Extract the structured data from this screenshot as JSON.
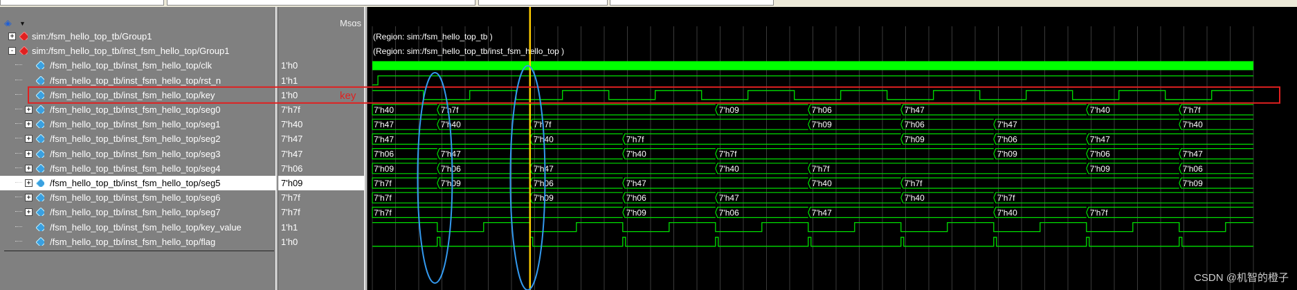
{
  "header": {
    "msgs_label": "Msgs"
  },
  "signals": [
    {
      "name": "sim:/fsm_hello_top_tb/Group1",
      "value": "",
      "kind": "group",
      "expander": "+",
      "indent": 0
    },
    {
      "name": "sim:/fsm_hello_top_tb/inst_fsm_hello_top/Group1",
      "value": "",
      "kind": "group",
      "expander": "-",
      "indent": 0
    },
    {
      "name": "/fsm_hello_top_tb/inst_fsm_hello_top/clk",
      "value": "1'h0",
      "kind": "bit",
      "expander": "",
      "indent": 1
    },
    {
      "name": "/fsm_hello_top_tb/inst_fsm_hello_top/rst_n",
      "value": "1'h1",
      "kind": "bit",
      "expander": "",
      "indent": 1
    },
    {
      "name": "/fsm_hello_top_tb/inst_fsm_hello_top/key",
      "value": "1'h0",
      "kind": "bit",
      "expander": "",
      "indent": 1
    },
    {
      "name": "/fsm_hello_top_tb/inst_fsm_hello_top/seg0",
      "value": "7'h7f",
      "kind": "bus",
      "expander": "+",
      "indent": 1
    },
    {
      "name": "/fsm_hello_top_tb/inst_fsm_hello_top/seg1",
      "value": "7'h40",
      "kind": "bus",
      "expander": "+",
      "indent": 1
    },
    {
      "name": "/fsm_hello_top_tb/inst_fsm_hello_top/seg2",
      "value": "7'h47",
      "kind": "bus",
      "expander": "+",
      "indent": 1
    },
    {
      "name": "/fsm_hello_top_tb/inst_fsm_hello_top/seg3",
      "value": "7'h47",
      "kind": "bus",
      "expander": "+",
      "indent": 1
    },
    {
      "name": "/fsm_hello_top_tb/inst_fsm_hello_top/seg4",
      "value": "7'h06",
      "kind": "bus",
      "expander": "+",
      "indent": 1
    },
    {
      "name": "/fsm_hello_top_tb/inst_fsm_hello_top/seg5",
      "value": "7'h09",
      "kind": "bus",
      "expander": "+",
      "indent": 1,
      "selected": true
    },
    {
      "name": "/fsm_hello_top_tb/inst_fsm_hello_top/seg6",
      "value": "7'h7f",
      "kind": "bus",
      "expander": "+",
      "indent": 1
    },
    {
      "name": "/fsm_hello_top_tb/inst_fsm_hello_top/seg7",
      "value": "7'h7f",
      "kind": "bus",
      "expander": "+",
      "indent": 1
    },
    {
      "name": "/fsm_hello_top_tb/inst_fsm_hello_top/key_value",
      "value": "1'h1",
      "kind": "bit",
      "expander": "",
      "indent": 1
    },
    {
      "name": "/fsm_hello_top_tb/inst_fsm_hello_top/flag",
      "value": "1'h0",
      "kind": "bit",
      "expander": "",
      "indent": 1
    }
  ],
  "waves": {
    "region_labels": [
      "(Region: sim:/fsm_hello_top_tb )",
      "(Region: sim:/fsm_hello_top_tb/inst_fsm_hello_top )"
    ],
    "rst_n_high_from": 0.12,
    "key_pulses": [
      [
        1.1,
        2.1
      ],
      [
        3.1,
        4.1
      ],
      [
        5.1,
        6.1
      ],
      [
        7.1,
        8.1
      ],
      [
        9.1,
        10.1
      ],
      [
        11.1,
        12.1
      ],
      [
        13.1,
        14.1
      ],
      [
        15.1,
        16.1
      ],
      [
        17.1,
        18.1
      ]
    ],
    "buses": {
      "seg0": [
        [
          0,
          "7'h40"
        ],
        [
          1.4,
          "7'h7f"
        ],
        [
          7.4,
          "7'h09"
        ],
        [
          9.4,
          "7'h06"
        ],
        [
          11.4,
          "7'h47"
        ],
        [
          15.4,
          "7'h40"
        ],
        [
          17.4,
          "7'h7f"
        ]
      ],
      "seg1": [
        [
          0,
          "7'h47"
        ],
        [
          1.4,
          "7'h40"
        ],
        [
          3.4,
          "7'h7f"
        ],
        [
          9.4,
          "7'h09"
        ],
        [
          11.4,
          "7'h06"
        ],
        [
          13.4,
          "7'h47"
        ],
        [
          17.4,
          "7'h40"
        ]
      ],
      "seg2": [
        [
          0,
          "7'h47"
        ],
        [
          3.4,
          "7'h40"
        ],
        [
          5.4,
          "7'h7f"
        ],
        [
          11.4,
          "7'h09"
        ],
        [
          13.4,
          "7'h06"
        ],
        [
          15.4,
          "7'h47"
        ]
      ],
      "seg3": [
        [
          0,
          "7'h06"
        ],
        [
          1.4,
          "7'h47"
        ],
        [
          5.4,
          "7'h40"
        ],
        [
          7.4,
          "7'h7f"
        ],
        [
          13.4,
          "7'h09"
        ],
        [
          15.4,
          "7'h06"
        ],
        [
          17.4,
          "7'h47"
        ]
      ],
      "seg4": [
        [
          0,
          "7'h09"
        ],
        [
          1.4,
          "7'h06"
        ],
        [
          3.4,
          "7'h47"
        ],
        [
          7.4,
          "7'h40"
        ],
        [
          9.4,
          "7'h7f"
        ],
        [
          15.4,
          "7'h09"
        ],
        [
          17.4,
          "7'h06"
        ]
      ],
      "seg5": [
        [
          0,
          "7'h7f"
        ],
        [
          1.4,
          "7'h09"
        ],
        [
          3.4,
          "7'h06"
        ],
        [
          5.4,
          "7'h47"
        ],
        [
          9.4,
          "7'h40"
        ],
        [
          11.4,
          "7'h7f"
        ],
        [
          17.4,
          "7'h09"
        ]
      ],
      "seg6": [
        [
          0,
          "7'h7f"
        ],
        [
          3.4,
          "7'h09"
        ],
        [
          5.4,
          "7'h06"
        ],
        [
          7.4,
          "7'h47"
        ],
        [
          11.4,
          "7'h40"
        ],
        [
          13.4,
          "7'h7f"
        ]
      ],
      "seg7": [
        [
          0,
          "7'h7f"
        ],
        [
          5.4,
          "7'h09"
        ],
        [
          7.4,
          "7'h06"
        ],
        [
          9.4,
          "7'h47"
        ],
        [
          13.4,
          "7'h40"
        ],
        [
          15.4,
          "7'h7f"
        ]
      ]
    },
    "key_value_levels": [
      [
        0,
        1
      ],
      [
        1.4,
        0
      ],
      [
        2.4,
        1
      ],
      [
        3.4,
        0
      ],
      [
        4.4,
        1
      ],
      [
        5.4,
        0
      ],
      [
        6.4,
        1
      ],
      [
        7.4,
        0
      ],
      [
        8.4,
        1
      ],
      [
        9.4,
        0
      ],
      [
        10.4,
        1
      ],
      [
        11.4,
        0
      ],
      [
        12.4,
        1
      ],
      [
        13.4,
        0
      ],
      [
        14.4,
        1
      ],
      [
        15.4,
        0
      ],
      [
        16.4,
        1
      ],
      [
        17.4,
        0
      ],
      [
        18.4,
        1
      ]
    ],
    "flag_pulses": [
      1.4,
      3.4,
      5.4,
      7.4,
      9.4,
      11.4,
      13.4,
      15.4,
      17.4
    ],
    "cursor_time": 3.4,
    "end_time": 19.0
  },
  "annotations": {
    "key_box_label": "key"
  },
  "watermark": "CSDN @机智的橙子",
  "colors": {
    "wave": "#00e000",
    "clk_fill": "#00ff00",
    "cursor": "#ffcc00",
    "annot_red": "#e02020",
    "annot_blue": "#3399ee"
  }
}
